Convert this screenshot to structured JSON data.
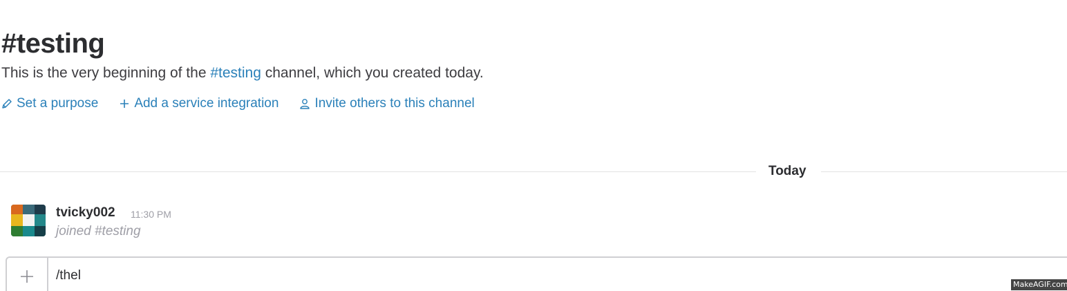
{
  "channel": {
    "title": "#testing",
    "intro_prefix": "This is the very beginning of the ",
    "intro_link": "#testing",
    "intro_suffix": " channel, which you created today."
  },
  "actions": [
    {
      "icon": "pencil-icon",
      "label": "Set a purpose"
    },
    {
      "icon": "plus-icon",
      "label": "Add a service integration"
    },
    {
      "icon": "person-icon",
      "label": "Invite others to this channel"
    }
  ],
  "divider": {
    "label": "Today"
  },
  "messages": [
    {
      "user": "tvicky002",
      "time": "11:30 PM",
      "text": "joined #testing",
      "avatar_icon": "patchwork-avatar-icon"
    }
  ],
  "composer": {
    "value": "/thel",
    "attach_icon": "plus-icon"
  },
  "watermark": {
    "text": "MakeAGIF.com"
  },
  "colors": {
    "link": "#2a80b9",
    "text": "#2c2d30",
    "muted": "#9e9ea6",
    "border": "#cfcfd2"
  }
}
